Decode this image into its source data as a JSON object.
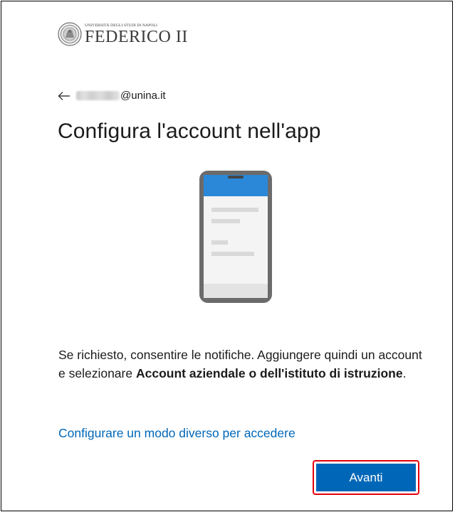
{
  "header": {
    "logo_top_text": "UNIVERSITÀ DEGLI STUDI DI NAPOLI",
    "logo_main_text": "FEDERICO II"
  },
  "identity": {
    "email_domain": "@unina.it"
  },
  "page": {
    "title": "Configura l'account nell'app",
    "description_plain": "Se richiesto, consentire le notifiche. Aggiungere quindi un account e selezionare ",
    "description_bold": "Account aziendale o dell'istituto di istruzione",
    "description_end": ".",
    "alt_link": "Configurare un modo diverso per accedere"
  },
  "actions": {
    "next_label": "Avanti"
  },
  "colors": {
    "accent": "#0067b8",
    "highlight_outline": "#e3000b",
    "phone_screen_header": "#2b88d8"
  },
  "icons": {
    "back": "arrow-left-icon",
    "seal": "university-seal-icon",
    "illustration": "smartphone-icon"
  }
}
